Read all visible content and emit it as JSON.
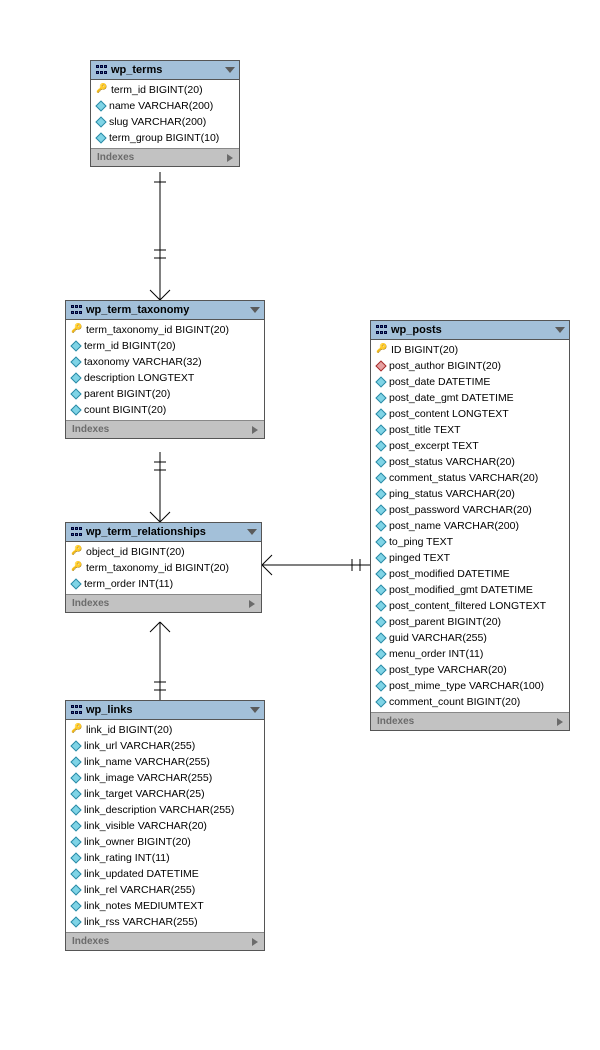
{
  "tables": {
    "wp_terms": {
      "title": "wp_terms",
      "indexes_label": "Indexes",
      "columns": [
        {
          "icon": "key",
          "text": "term_id BIGINT(20)"
        },
        {
          "icon": "diamond",
          "text": "name VARCHAR(200)"
        },
        {
          "icon": "diamond",
          "text": "slug VARCHAR(200)"
        },
        {
          "icon": "diamond",
          "text": "term_group BIGINT(10)"
        }
      ]
    },
    "wp_term_taxonomy": {
      "title": "wp_term_taxonomy",
      "indexes_label": "Indexes",
      "columns": [
        {
          "icon": "key",
          "text": "term_taxonomy_id BIGINT(20)"
        },
        {
          "icon": "diamond",
          "text": "term_id BIGINT(20)"
        },
        {
          "icon": "diamond",
          "text": "taxonomy VARCHAR(32)"
        },
        {
          "icon": "diamond",
          "text": "description LONGTEXT"
        },
        {
          "icon": "diamond",
          "text": "parent BIGINT(20)"
        },
        {
          "icon": "diamond",
          "text": "count BIGINT(20)"
        }
      ]
    },
    "wp_term_relationships": {
      "title": "wp_term_relationships",
      "indexes_label": "Indexes",
      "columns": [
        {
          "icon": "key",
          "text": "object_id BIGINT(20)"
        },
        {
          "icon": "key",
          "text": "term_taxonomy_id BIGINT(20)"
        },
        {
          "icon": "diamond",
          "text": "term_order INT(11)"
        }
      ]
    },
    "wp_links": {
      "title": "wp_links",
      "indexes_label": "Indexes",
      "columns": [
        {
          "icon": "key",
          "text": "link_id BIGINT(20)"
        },
        {
          "icon": "diamond",
          "text": "link_url VARCHAR(255)"
        },
        {
          "icon": "diamond",
          "text": "link_name VARCHAR(255)"
        },
        {
          "icon": "diamond",
          "text": "link_image VARCHAR(255)"
        },
        {
          "icon": "diamond",
          "text": "link_target VARCHAR(25)"
        },
        {
          "icon": "diamond",
          "text": "link_description VARCHAR(255)"
        },
        {
          "icon": "diamond",
          "text": "link_visible VARCHAR(20)"
        },
        {
          "icon": "diamond",
          "text": "link_owner BIGINT(20)"
        },
        {
          "icon": "diamond",
          "text": "link_rating INT(11)"
        },
        {
          "icon": "diamond",
          "text": "link_updated DATETIME"
        },
        {
          "icon": "diamond",
          "text": "link_rel VARCHAR(255)"
        },
        {
          "icon": "diamond",
          "text": "link_notes MEDIUMTEXT"
        },
        {
          "icon": "diamond",
          "text": "link_rss VARCHAR(255)"
        }
      ]
    },
    "wp_posts": {
      "title": "wp_posts",
      "indexes_label": "Indexes",
      "columns": [
        {
          "icon": "key",
          "text": "ID BIGINT(20)"
        },
        {
          "icon": "diamond-red",
          "text": "post_author BIGINT(20)"
        },
        {
          "icon": "diamond",
          "text": "post_date DATETIME"
        },
        {
          "icon": "diamond",
          "text": "post_date_gmt DATETIME"
        },
        {
          "icon": "diamond",
          "text": "post_content LONGTEXT"
        },
        {
          "icon": "diamond",
          "text": "post_title TEXT"
        },
        {
          "icon": "diamond",
          "text": "post_excerpt TEXT"
        },
        {
          "icon": "diamond",
          "text": "post_status VARCHAR(20)"
        },
        {
          "icon": "diamond",
          "text": "comment_status VARCHAR(20)"
        },
        {
          "icon": "diamond",
          "text": "ping_status VARCHAR(20)"
        },
        {
          "icon": "diamond",
          "text": "post_password VARCHAR(20)"
        },
        {
          "icon": "diamond",
          "text": "post_name VARCHAR(200)"
        },
        {
          "icon": "diamond",
          "text": "to_ping TEXT"
        },
        {
          "icon": "diamond",
          "text": "pinged TEXT"
        },
        {
          "icon": "diamond",
          "text": "post_modified DATETIME"
        },
        {
          "icon": "diamond",
          "text": "post_modified_gmt DATETIME"
        },
        {
          "icon": "diamond",
          "text": "post_content_filtered LONGTEXT"
        },
        {
          "icon": "diamond",
          "text": "post_parent BIGINT(20)"
        },
        {
          "icon": "diamond",
          "text": "guid VARCHAR(255)"
        },
        {
          "icon": "diamond",
          "text": "menu_order INT(11)"
        },
        {
          "icon": "diamond",
          "text": "post_type VARCHAR(20)"
        },
        {
          "icon": "diamond",
          "text": "post_mime_type VARCHAR(100)"
        },
        {
          "icon": "diamond",
          "text": "comment_count BIGINT(20)"
        }
      ]
    }
  },
  "chart_data": {
    "type": "erd",
    "entities": [
      {
        "name": "wp_terms",
        "columns": [
          {
            "name": "term_id",
            "type": "BIGINT(20)",
            "pk": true
          },
          {
            "name": "name",
            "type": "VARCHAR(200)"
          },
          {
            "name": "slug",
            "type": "VARCHAR(200)"
          },
          {
            "name": "term_group",
            "type": "BIGINT(10)"
          }
        ]
      },
      {
        "name": "wp_term_taxonomy",
        "columns": [
          {
            "name": "term_taxonomy_id",
            "type": "BIGINT(20)",
            "pk": true
          },
          {
            "name": "term_id",
            "type": "BIGINT(20)"
          },
          {
            "name": "taxonomy",
            "type": "VARCHAR(32)"
          },
          {
            "name": "description",
            "type": "LONGTEXT"
          },
          {
            "name": "parent",
            "type": "BIGINT(20)"
          },
          {
            "name": "count",
            "type": "BIGINT(20)"
          }
        ]
      },
      {
        "name": "wp_term_relationships",
        "columns": [
          {
            "name": "object_id",
            "type": "BIGINT(20)",
            "pk": true
          },
          {
            "name": "term_taxonomy_id",
            "type": "BIGINT(20)",
            "pk": true
          },
          {
            "name": "term_order",
            "type": "INT(11)"
          }
        ]
      },
      {
        "name": "wp_links",
        "columns": [
          {
            "name": "link_id",
            "type": "BIGINT(20)",
            "pk": true
          },
          {
            "name": "link_url",
            "type": "VARCHAR(255)"
          },
          {
            "name": "link_name",
            "type": "VARCHAR(255)"
          },
          {
            "name": "link_image",
            "type": "VARCHAR(255)"
          },
          {
            "name": "link_target",
            "type": "VARCHAR(25)"
          },
          {
            "name": "link_description",
            "type": "VARCHAR(255)"
          },
          {
            "name": "link_visible",
            "type": "VARCHAR(20)"
          },
          {
            "name": "link_owner",
            "type": "BIGINT(20)"
          },
          {
            "name": "link_rating",
            "type": "INT(11)"
          },
          {
            "name": "link_updated",
            "type": "DATETIME"
          },
          {
            "name": "link_rel",
            "type": "VARCHAR(255)"
          },
          {
            "name": "link_notes",
            "type": "MEDIUMTEXT"
          },
          {
            "name": "link_rss",
            "type": "VARCHAR(255)"
          }
        ]
      },
      {
        "name": "wp_posts",
        "columns": [
          {
            "name": "ID",
            "type": "BIGINT(20)",
            "pk": true
          },
          {
            "name": "post_author",
            "type": "BIGINT(20)",
            "fk": true
          },
          {
            "name": "post_date",
            "type": "DATETIME"
          },
          {
            "name": "post_date_gmt",
            "type": "DATETIME"
          },
          {
            "name": "post_content",
            "type": "LONGTEXT"
          },
          {
            "name": "post_title",
            "type": "TEXT"
          },
          {
            "name": "post_excerpt",
            "type": "TEXT"
          },
          {
            "name": "post_status",
            "type": "VARCHAR(20)"
          },
          {
            "name": "comment_status",
            "type": "VARCHAR(20)"
          },
          {
            "name": "ping_status",
            "type": "VARCHAR(20)"
          },
          {
            "name": "post_password",
            "type": "VARCHAR(20)"
          },
          {
            "name": "post_name",
            "type": "VARCHAR(200)"
          },
          {
            "name": "to_ping",
            "type": "TEXT"
          },
          {
            "name": "pinged",
            "type": "TEXT"
          },
          {
            "name": "post_modified",
            "type": "DATETIME"
          },
          {
            "name": "post_modified_gmt",
            "type": "DATETIME"
          },
          {
            "name": "post_content_filtered",
            "type": "LONGTEXT"
          },
          {
            "name": "post_parent",
            "type": "BIGINT(20)"
          },
          {
            "name": "guid",
            "type": "VARCHAR(255)"
          },
          {
            "name": "menu_order",
            "type": "INT(11)"
          },
          {
            "name": "post_type",
            "type": "VARCHAR(20)"
          },
          {
            "name": "post_mime_type",
            "type": "VARCHAR(100)"
          },
          {
            "name": "comment_count",
            "type": "BIGINT(20)"
          }
        ]
      }
    ],
    "relationships": [
      {
        "from": "wp_term_taxonomy.term_id",
        "to": "wp_terms.term_id",
        "cardinality": "many-to-one"
      },
      {
        "from": "wp_term_relationships.term_taxonomy_id",
        "to": "wp_term_taxonomy.term_taxonomy_id",
        "cardinality": "many-to-one"
      },
      {
        "from": "wp_term_relationships.object_id",
        "to": "wp_links.link_id",
        "cardinality": "many-to-one"
      },
      {
        "from": "wp_term_relationships.object_id",
        "to": "wp_posts.ID",
        "cardinality": "many-to-one"
      }
    ]
  }
}
